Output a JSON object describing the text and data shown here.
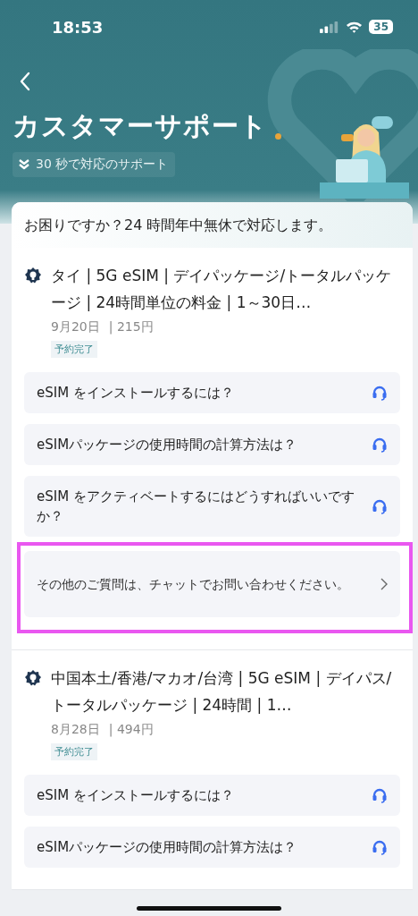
{
  "status_bar": {
    "time": "18:53",
    "battery": "35"
  },
  "header": {
    "title": "カスタマーサポート",
    "badge": "30 秒で対応のサポート"
  },
  "intro": "お困りですか？24 時間年中無休で対応します。",
  "orders": [
    {
      "title": "タイ | 5G eSIM | デイパッケージ/トータルパッケージ | 24時間単位の料金 | 1～30日…",
      "date": "9月20日",
      "price": "| 215円",
      "status": "予約完了",
      "questions": [
        {
          "kind": "faq",
          "text": "eSIM をインストールするには？"
        },
        {
          "kind": "faq",
          "text": "eSIMパッケージの使用時間の計算方法は？"
        },
        {
          "kind": "faq",
          "text": "eSIM をアクティベートするにはどうすればいいですか？"
        },
        {
          "kind": "chat",
          "text": "その他のご質問は、チャットでお問い合わせください。",
          "highlighted": true
        }
      ]
    },
    {
      "title": "中国本土/香港/マカオ/台湾 | 5G eSIM | デイパス/トータルパッケージ | 24時間 | 1…",
      "date": "8月28日",
      "price": "| 494円",
      "status": "予約完了",
      "questions": [
        {
          "kind": "faq",
          "text": "eSIM をインストールするには？"
        },
        {
          "kind": "faq",
          "text": "eSIMパッケージの使用時間の計算方法は？"
        }
      ]
    }
  ]
}
